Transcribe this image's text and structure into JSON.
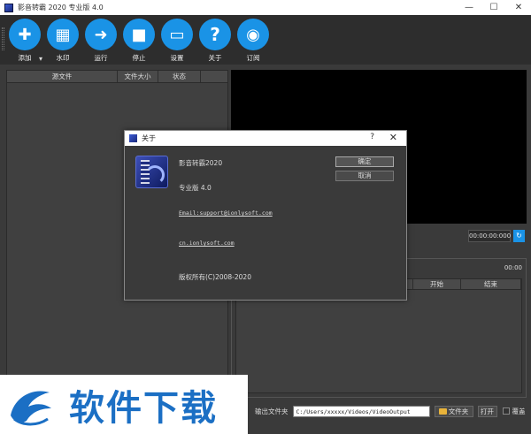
{
  "window": {
    "title": "影音转霸 2020 专业版 4.0",
    "controls": [
      "—",
      "☐",
      "✕"
    ]
  },
  "toolbar": {
    "buttons": [
      {
        "label": "添加",
        "icon": "plus-icon",
        "glyph": "✚"
      },
      {
        "label": "水印",
        "icon": "film-icon",
        "glyph": "▦"
      },
      {
        "label": "运行",
        "icon": "arrow-right-icon",
        "glyph": "➜"
      },
      {
        "label": "停止",
        "icon": "stop-icon",
        "glyph": "■"
      },
      {
        "label": "设置",
        "icon": "monitor-icon",
        "glyph": "▭"
      },
      {
        "label": "关于",
        "icon": "question-icon",
        "glyph": "?"
      },
      {
        "label": "订阅",
        "icon": "rss-icon",
        "glyph": "◉"
      }
    ],
    "dropdown_glyph": "▾"
  },
  "file_list": {
    "columns": [
      "源文件",
      "文件大小",
      "状态"
    ]
  },
  "preview": {
    "time": "00:00:00:000",
    "refresh_glyph": "↻"
  },
  "segments": {
    "time": "00:00",
    "columns": [
      "",
      "开始",
      "结束"
    ]
  },
  "output": {
    "label": "输出文件夹",
    "path": "C:/Users/xxxxx/Videos/VideoOutput",
    "folder_button": "文件夹",
    "open_button": "打开",
    "overwrite_label": "覆盖"
  },
  "watermark": {
    "text": "软件下载"
  },
  "about_dialog": {
    "title": "关于",
    "help_glyph": "?",
    "close_glyph": "✕",
    "product": "影音转霸2020",
    "edition": "专业版 4.0",
    "email": "Email:support@ionlysoft.com",
    "website": "cn.ionlysoft.com",
    "copyright": "版权所有(C)2008-2020",
    "ok_button": "确定",
    "cancel_button": "取消"
  },
  "colors": {
    "accent": "#1a93e6",
    "background": "#3a3a3a",
    "preview": "#000000"
  }
}
